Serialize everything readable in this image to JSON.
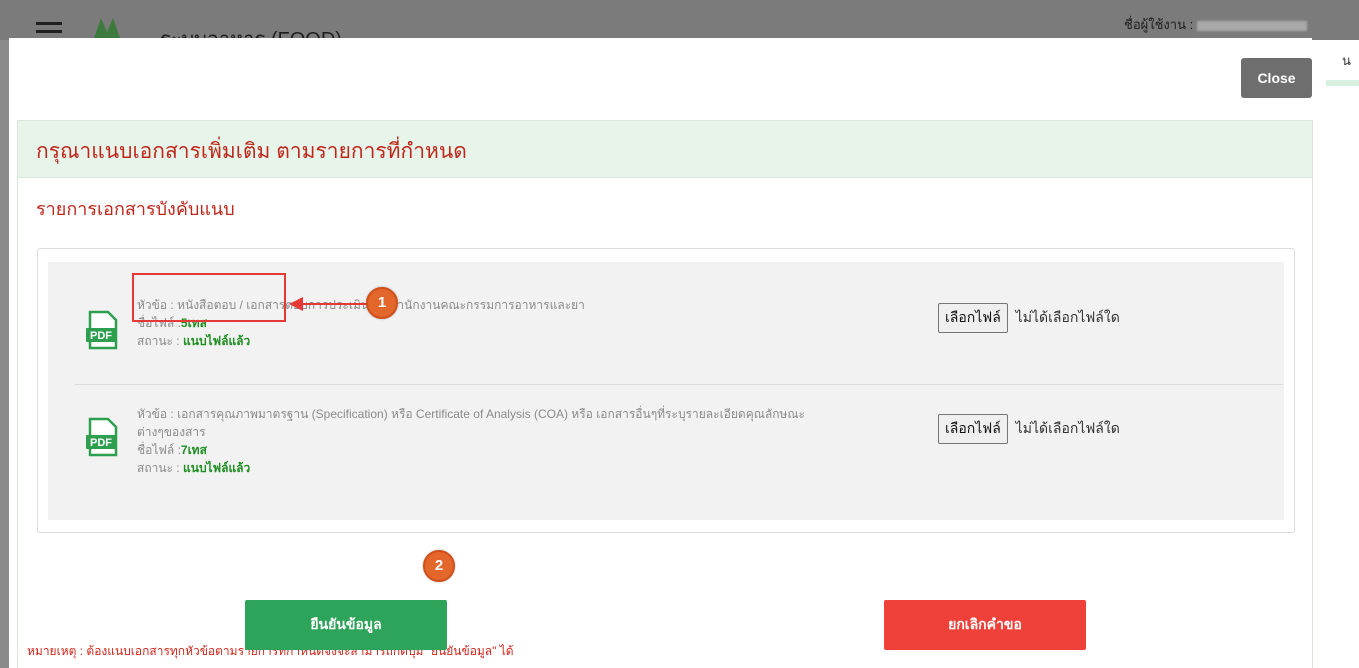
{
  "background": {
    "system_title": "ระบบอาหาร (FOOD)",
    "user_label": "ชื่อผู้ใช้งาน :",
    "side_text": "น"
  },
  "modal": {
    "close_label": "Close",
    "panel_title": "กรุณาแนบเอกสารเพิ่มเติม ตามรายการที่กำหนด",
    "section_title": "รายการเอกสารบังคับแนบ",
    "documents": [
      {
        "topic_label": "หัวข้อ :",
        "topic": "หนังสือตอบ / เอกสารตอบการประเมินจากสำนักงานคณะกรรมการอาหารและยา",
        "topic_line2": "",
        "filename_label": "ชื่อไฟล์ :",
        "filename": "5เทส",
        "status_label": "สถานะ :",
        "status": "แนบไฟล์แล้ว",
        "choose_button": "เลือกไฟล์",
        "no_file_text": "ไม่ได้เลือกไฟล์ใด"
      },
      {
        "topic_label": "หัวข้อ :",
        "topic": "เอกสารคุณภาพมาตรฐาน (Specification) หรือ Certificate of Analysis (COA) หรือ เอกสารอื่นๆที่ระบุรายละเอียดคุณลักษณะ",
        "topic_line2": "ต่างๆของสาร",
        "filename_label": "ชื่อไฟล์ :",
        "filename": "7เทส",
        "status_label": "สถานะ :",
        "status": "แนบไฟล์แล้ว",
        "choose_button": "เลือกไฟล์",
        "no_file_text": "ไม่ได้เลือกไฟล์ใด"
      }
    ],
    "note": "หมายเหตุ : ต้องแนบเอกสารทุกหัวข้อตามรายการที่กำหนดจึงจะสามารถกดปุ่ม \"ยืนยันข้อมูล\" ได้",
    "confirm_button": "ยืนยันข้อมูล",
    "cancel_button": "ยกเลิกคำขอ"
  },
  "annotations": {
    "badge1": "1",
    "badge2": "2"
  },
  "colors": {
    "title_red": "#c0271b",
    "status_green": "#1f8f22",
    "confirm_green": "#2ea35a",
    "cancel_red": "#f0403a",
    "badge_orange": "#e3662a",
    "highlight_red": "#e53935"
  },
  "icons": {
    "pdf": "pdf-file-icon",
    "menu": "hamburger-menu-icon",
    "logo": "food-system-logo"
  }
}
